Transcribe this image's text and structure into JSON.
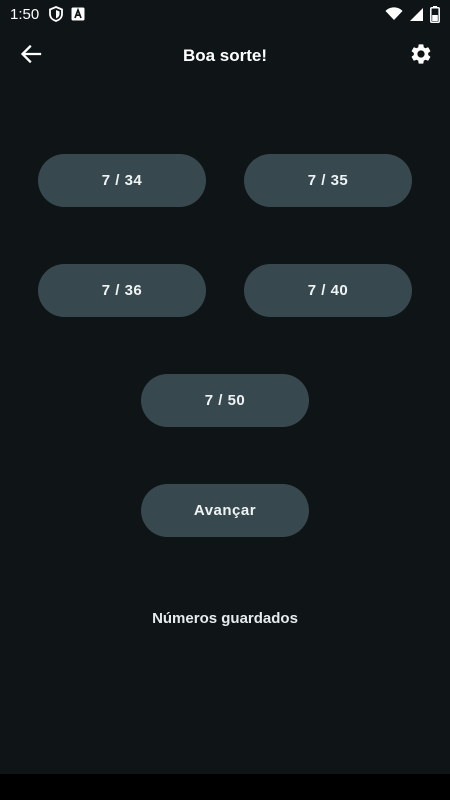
{
  "status_bar": {
    "time": "1:50",
    "left_icons": [
      "shield-icon",
      "font-a-icon"
    ],
    "right_icons": [
      "wifi-icon",
      "signal-icon",
      "battery-icon"
    ]
  },
  "app_bar": {
    "title": "Boa sorte!",
    "back_icon": "arrow-left-icon",
    "settings_icon": "gear-icon"
  },
  "options": [
    {
      "label": "7 / 34"
    },
    {
      "label": "7 / 35"
    },
    {
      "label": "7 / 36"
    },
    {
      "label": "7 / 40"
    },
    {
      "label": "7 / 50"
    }
  ],
  "advance_button": {
    "label": "Avançar"
  },
  "saved_numbers_label": "Números guardados",
  "colors": {
    "background": "#0f1417",
    "button": "#37494f",
    "text": "#ffffff"
  }
}
